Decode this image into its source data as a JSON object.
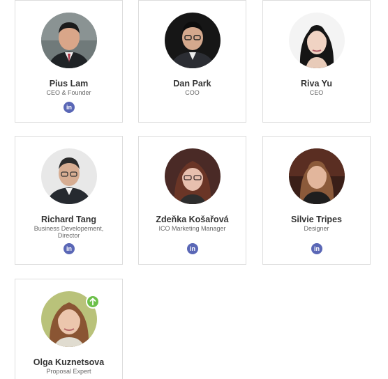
{
  "colors": {
    "linkedin_button": "#5a67b6",
    "card_border": "#dddddd",
    "name_text": "#333333",
    "role_text": "#666666",
    "badge_green": "#6cc04a"
  },
  "team": [
    {
      "name": "Pius Lam",
      "role": "CEO & Founder",
      "linkedin": "in",
      "icon": "linkedin-icon"
    },
    {
      "name": "Dan Park",
      "role": "COO"
    },
    {
      "name": "Riva Yu",
      "role": "CEO"
    },
    {
      "name": "Richard Tang",
      "role": "Business Developement, Director",
      "linkedin": "in",
      "icon": "linkedin-icon"
    },
    {
      "name": "Zdeňka Košařová",
      "role": "ICO Marketing Manager",
      "linkedin": "in",
      "icon": "linkedin-icon"
    },
    {
      "name": "Silvie Tripes",
      "role": "Designer",
      "linkedin": "in",
      "icon": "linkedin-icon"
    },
    {
      "name": "Olga Kuznetsova",
      "role": "Proposal Expert",
      "badge_icon": "arrow-up-icon"
    }
  ]
}
